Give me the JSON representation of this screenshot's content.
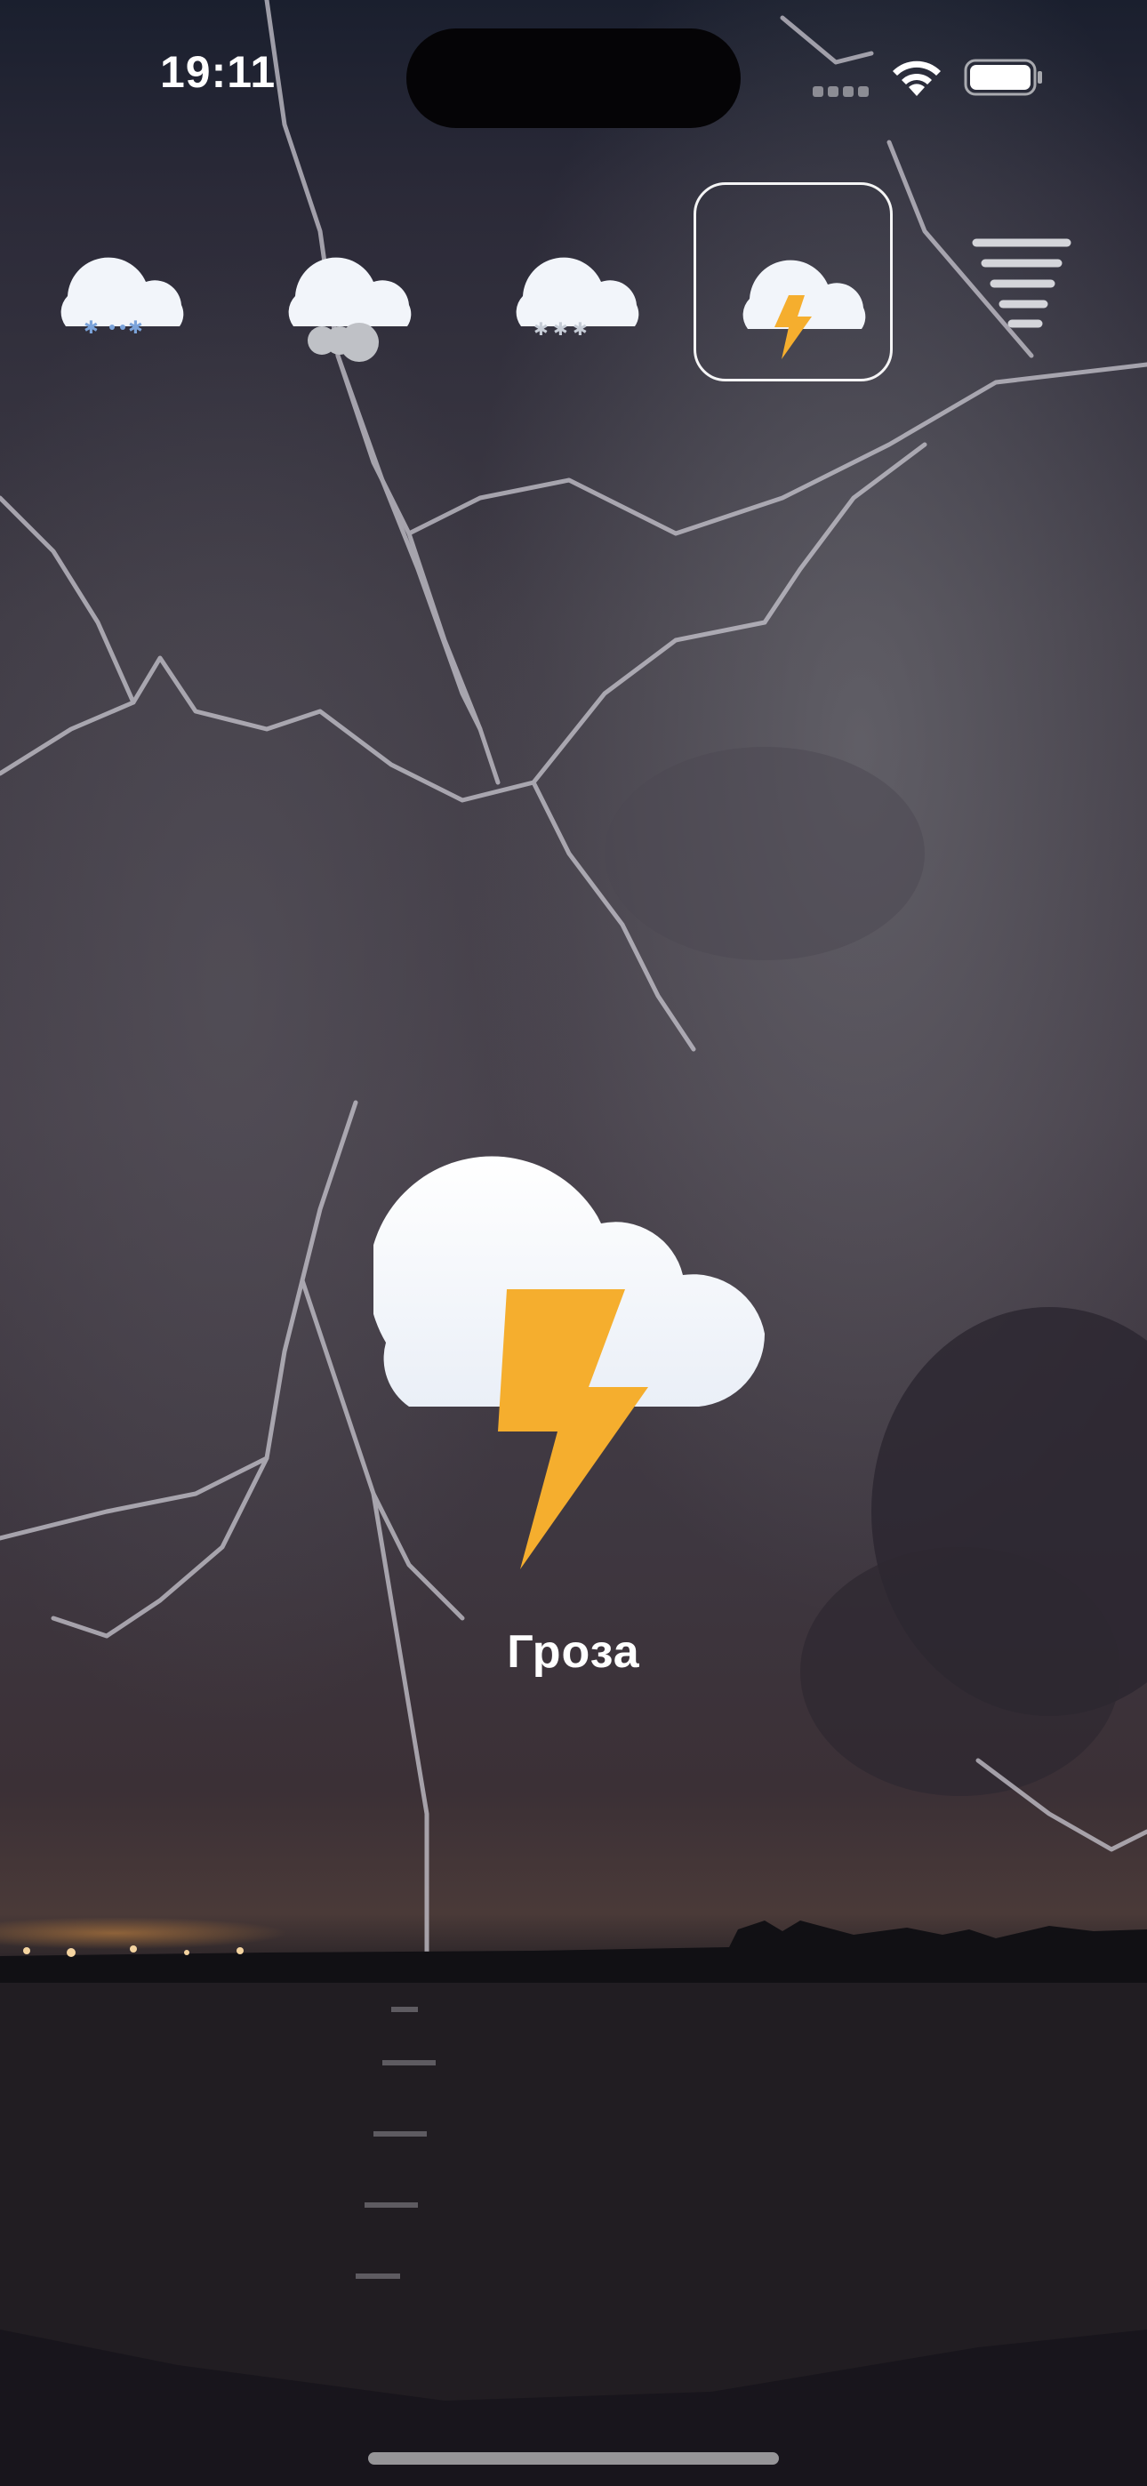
{
  "status_bar": {
    "time": "19:11"
  },
  "selector": {
    "items": [
      {
        "icon": "snow-cloud-icon"
      },
      {
        "icon": "fog-cloud-icon"
      },
      {
        "icon": "hail-cloud-icon"
      },
      {
        "icon": "thunderstorm-cloud-icon",
        "selected": true
      },
      {
        "icon": "tornado-icon"
      }
    ]
  },
  "main": {
    "icon": "thunderstorm-cloud-icon",
    "label": "Гроза"
  },
  "colors": {
    "lightning": "#F5AE2E",
    "cloud": "#F2F5FA",
    "snowflake": "#7BA3DA",
    "fog": "#BFC1C6"
  }
}
